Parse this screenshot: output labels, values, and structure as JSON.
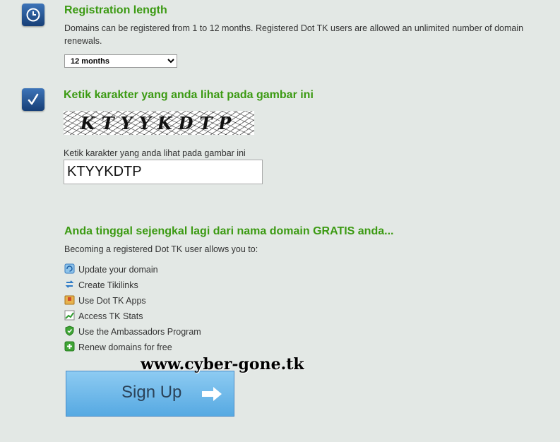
{
  "registration": {
    "title": "Registration length",
    "description": "Domains can be registered from 1 to 12 months. Registered Dot TK users are allowed an unlimited number of domain renewals.",
    "selected_period": "12 months"
  },
  "captcha": {
    "title": "Ketik karakter yang anda lihat pada gambar ini",
    "image_text": "KTYYKDTP",
    "input_label": "Ketik karakter yang anda lihat pada gambar ini",
    "input_value": "KTYYKDTP"
  },
  "promo": {
    "title": "Anda tinggal sejengkal lagi dari nama domain GRATIS anda...",
    "intro": "Becoming a registered Dot TK user allows you to:",
    "features": [
      {
        "label": "Update your domain",
        "icon": "update-icon"
      },
      {
        "label": "Create Tikilinks",
        "icon": "link-icon"
      },
      {
        "label": "Use Dot TK Apps",
        "icon": "apps-icon"
      },
      {
        "label": "Access TK Stats",
        "icon": "stats-icon"
      },
      {
        "label": "Use the Ambassadors Program",
        "icon": "shield-icon"
      },
      {
        "label": "Renew domains for free",
        "icon": "plus-icon"
      }
    ]
  },
  "signup": {
    "label": "Sign Up"
  },
  "watermark": "www.cyber-gone.tk",
  "colors": {
    "background": "#e3e8e5",
    "heading_green": "#3b9a12",
    "button_blue": "#6ab6e8"
  }
}
